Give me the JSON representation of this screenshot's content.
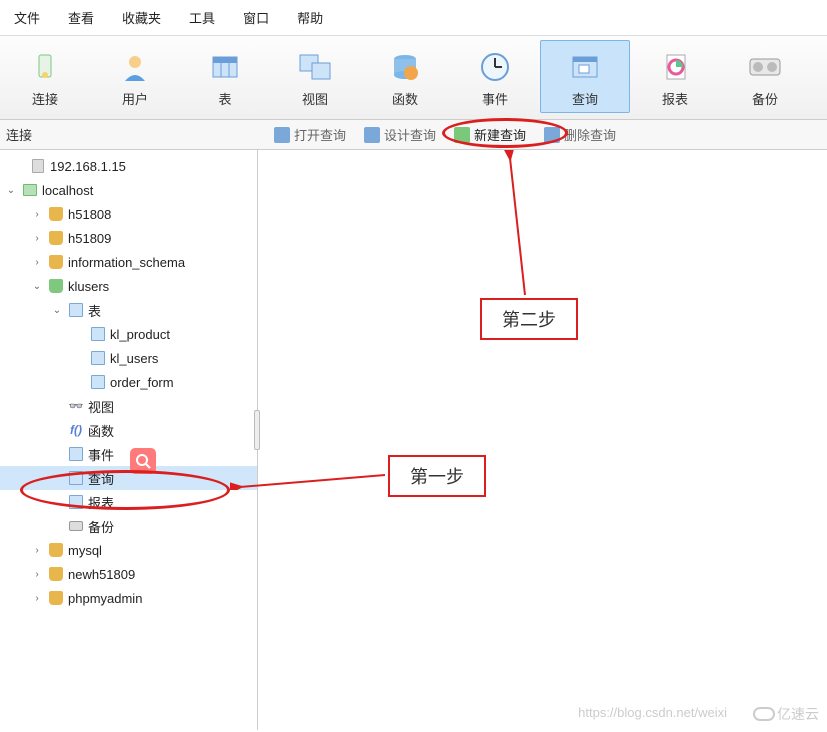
{
  "menu": [
    "文件",
    "查看",
    "收藏夹",
    "工具",
    "窗口",
    "帮助"
  ],
  "toolbar": [
    {
      "label": "连接",
      "icon": "connect-icon"
    },
    {
      "label": "用户",
      "icon": "user-icon"
    },
    {
      "label": "表",
      "icon": "table-icon"
    },
    {
      "label": "视图",
      "icon": "view-icon"
    },
    {
      "label": "函数",
      "icon": "function-icon"
    },
    {
      "label": "事件",
      "icon": "event-icon"
    },
    {
      "label": "查询",
      "icon": "query-icon",
      "active": true
    },
    {
      "label": "报表",
      "icon": "report-icon"
    },
    {
      "label": "备份",
      "icon": "backup-icon"
    }
  ],
  "subheader": {
    "label": "连接"
  },
  "sub_actions": [
    {
      "label": "打开查询"
    },
    {
      "label": "设计查询"
    },
    {
      "label": "新建查询"
    },
    {
      "label": "删除查询"
    }
  ],
  "tree": {
    "server1": {
      "label": "192.168.1.15"
    },
    "server2": {
      "label": "localhost"
    },
    "dbs": [
      "h51808",
      "h51809",
      "information_schema"
    ],
    "klusers": {
      "label": "klusers",
      "nodes": {
        "table": "表",
        "view": "视图",
        "fn": "函数",
        "event": "事件",
        "query": "查询",
        "report": "报表",
        "backup": "备份"
      },
      "tables": [
        "kl_product",
        "kl_users",
        "order_form"
      ]
    },
    "dbs2": [
      "mysql",
      "newh51809",
      "phpmyadmin"
    ]
  },
  "annotations": {
    "step1": "第一步",
    "step2": "第二步"
  },
  "watermark": {
    "url": "https://blog.csdn.net/weixi",
    "brand": "亿速云"
  }
}
